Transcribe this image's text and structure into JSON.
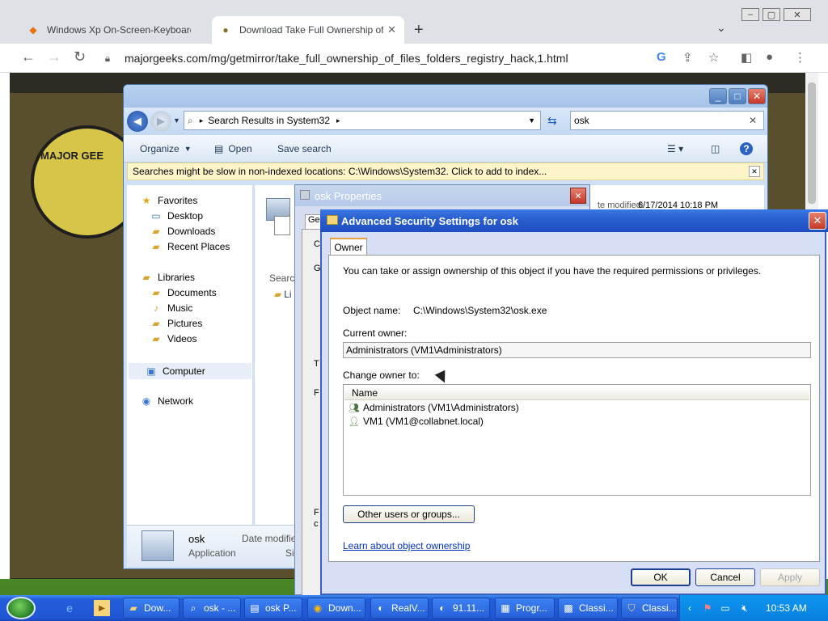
{
  "browser": {
    "tabs": [
      {
        "title": "Windows Xp On-Screen-Keyboard d",
        "icon": "diamond-icon"
      },
      {
        "title": "Download Take Full Ownership of Fi",
        "icon": "majorgeeks-icon"
      }
    ],
    "new_tab": "+",
    "url": "majorgeeks.com/mg/getmirror/take_full_ownership_of_files_folders_registry_hack,1.html",
    "win_controls": [
      "‒",
      "▢",
      "✕"
    ]
  },
  "webpage": {
    "logo_text": "MAJOR GEE"
  },
  "explorer": {
    "address": "Search Results in System32",
    "search_value": "osk",
    "commands": {
      "organize": "Organize",
      "open": "Open",
      "save_search": "Save search"
    },
    "info_bar": "Searches might be slow in non-indexed locations: C:\\Windows\\System32. Click to add to index...",
    "nav": {
      "favorites": "Favorites",
      "desktop": "Desktop",
      "downloads": "Downloads",
      "recent": "Recent Places",
      "libraries": "Libraries",
      "documents": "Documents",
      "music": "Music",
      "pictures": "Pictures",
      "videos": "Videos",
      "computer": "Computer",
      "network": "Network"
    },
    "content": {
      "date_modified_label": "te modified:",
      "date_modified_value": "6/17/2014 10:18 PM",
      "search_again": "Search",
      "lib_frag": "Li"
    },
    "details": {
      "name": "osk",
      "type": "Application",
      "date_label": "Date modifie",
      "size_frag": "Si"
    }
  },
  "osk_props": {
    "title": "osk Properties",
    "tab_frag": "Ge",
    "side_letters": [
      "C",
      "G",
      "T",
      "F",
      "F",
      "c"
    ]
  },
  "adv": {
    "title": "Advanced Security Settings for osk",
    "tab": "Owner",
    "intro": "You can take or assign ownership of this object if you have the required permissions or privileges.",
    "object_name_label": "Object name:",
    "object_name_value": "C:\\Windows\\System32\\osk.exe",
    "current_owner_label": "Current owner:",
    "current_owner_value": "Administrators (VM1\\Administrators)",
    "change_owner_label": "Change owner to:",
    "list_header": "Name",
    "owners": [
      {
        "name": "Administrators (VM1\\Administrators)",
        "icon": "group-icon"
      },
      {
        "name": "VM1 (VM1@collabnet.local)",
        "icon": "user-icon"
      }
    ],
    "other_users_button": "Other users or groups...",
    "learn_link": "Learn about object ownership",
    "ok": "OK",
    "cancel": "Cancel",
    "apply": "Apply"
  },
  "taskbar": {
    "buttons": [
      {
        "label": "Dow...",
        "icon": "folder-icon"
      },
      {
        "label": "osk - ...",
        "icon": "search-icon"
      },
      {
        "label": "osk P...",
        "icon": "properties-icon"
      },
      {
        "label": "Down...",
        "icon": "chrome-icon"
      },
      {
        "label": "RealV...",
        "icon": "realvnc-icon"
      },
      {
        "label": "91.11...",
        "icon": "vnc-icon"
      },
      {
        "label": "Progr...",
        "icon": "programs-icon"
      },
      {
        "label": "Classi...",
        "icon": "classic-icon"
      },
      {
        "label": "Classi...",
        "icon": "shield-icon"
      }
    ],
    "clock": "10:53 AM"
  }
}
